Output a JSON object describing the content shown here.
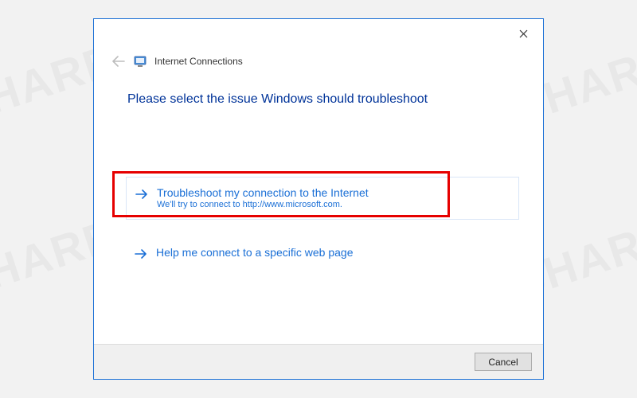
{
  "watermark": "SHAREUS",
  "dialog": {
    "title": "Internet Connections",
    "instruction": "Please select the issue Windows should troubleshoot",
    "options": [
      {
        "title": "Troubleshoot my connection to the Internet",
        "subtitle": "We'll try to connect to http://www.microsoft.com.",
        "highlighted": true
      },
      {
        "title": "Help me connect to a specific web page",
        "subtitle": "",
        "highlighted": false
      }
    ],
    "cancel_label": "Cancel"
  },
  "colors": {
    "dialog_border": "#1a6fd6",
    "link_blue": "#1a6fd6",
    "heading_blue": "#003399",
    "highlight_red": "#e60000"
  }
}
